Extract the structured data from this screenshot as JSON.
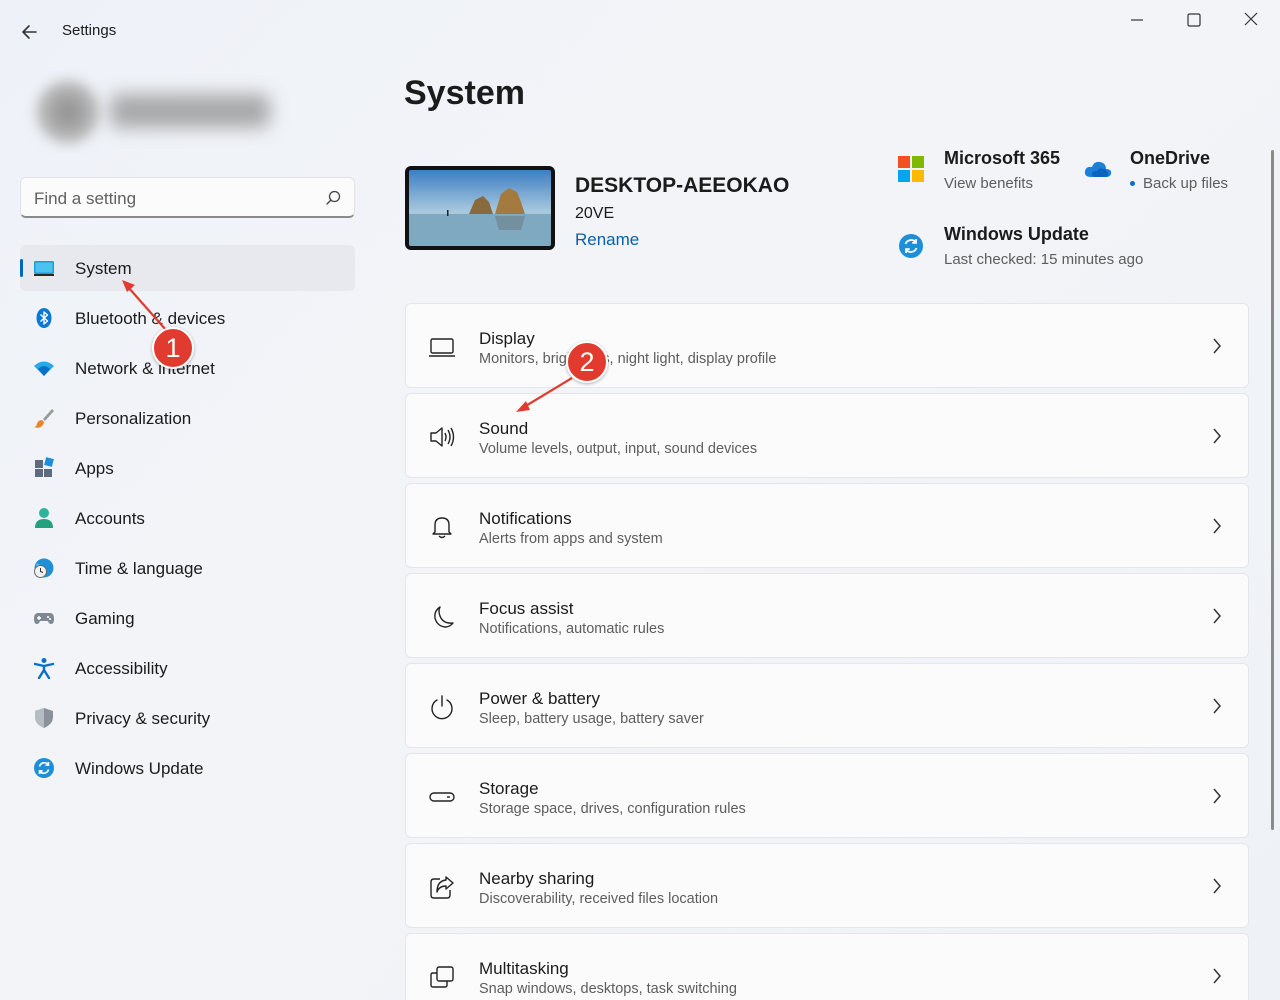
{
  "window": {
    "title": "Settings",
    "controls": {
      "minimize": "minimize",
      "maximize": "maximize",
      "close": "close"
    }
  },
  "search": {
    "placeholder": "Find a setting"
  },
  "sidebar": {
    "items": [
      {
        "label": "System",
        "icon": "system-icon",
        "active": true
      },
      {
        "label": "Bluetooth & devices",
        "icon": "bluetooth-icon"
      },
      {
        "label": "Network & internet",
        "icon": "wifi-icon"
      },
      {
        "label": "Personalization",
        "icon": "brush-icon"
      },
      {
        "label": "Apps",
        "icon": "apps-icon"
      },
      {
        "label": "Accounts",
        "icon": "accounts-icon"
      },
      {
        "label": "Time & language",
        "icon": "globe-clock-icon"
      },
      {
        "label": "Gaming",
        "icon": "gamepad-icon"
      },
      {
        "label": "Accessibility",
        "icon": "accessibility-icon"
      },
      {
        "label": "Privacy & security",
        "icon": "shield-icon"
      },
      {
        "label": "Windows Update",
        "icon": "update-icon"
      }
    ]
  },
  "main": {
    "title": "System",
    "device": {
      "name": "DESKTOP-AEEOKAO",
      "model": "20VE",
      "rename": "Rename"
    },
    "quick_links": [
      {
        "title": "Microsoft 365",
        "sub": "View benefits",
        "icon": "microsoft-logo-icon"
      },
      {
        "title": "OneDrive",
        "sub": "Back up files",
        "icon": "onedrive-cloud-icon"
      },
      {
        "title": "Windows Update",
        "sub": "Last checked: 15 minutes ago",
        "icon": "windows-update-icon"
      }
    ],
    "cards": [
      {
        "title": "Display",
        "desc": "Monitors, brightness, night light, display profile",
        "icon": "display-icon"
      },
      {
        "title": "Sound",
        "desc": "Volume levels, output, input, sound devices",
        "icon": "speaker-icon"
      },
      {
        "title": "Notifications",
        "desc": "Alerts from apps and system",
        "icon": "bell-icon"
      },
      {
        "title": "Focus assist",
        "desc": "Notifications, automatic rules",
        "icon": "moon-icon"
      },
      {
        "title": "Power & battery",
        "desc": "Sleep, battery usage, battery saver",
        "icon": "power-icon"
      },
      {
        "title": "Storage",
        "desc": "Storage space, drives, configuration rules",
        "icon": "storage-icon"
      },
      {
        "title": "Nearby sharing",
        "desc": "Discoverability, received files location",
        "icon": "share-icon"
      },
      {
        "title": "Multitasking",
        "desc": "Snap windows, desktops, task switching",
        "icon": "multitasking-icon"
      }
    ]
  },
  "annotations": [
    {
      "label": "1"
    },
    {
      "label": "2"
    }
  ],
  "colors": {
    "accent": "#0067c0",
    "annotation": "#e03b2e"
  }
}
